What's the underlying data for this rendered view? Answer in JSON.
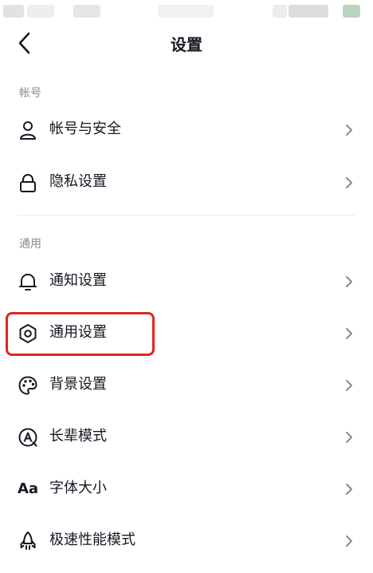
{
  "header": {
    "title": "设置"
  },
  "sections": [
    {
      "title": "帐号",
      "items": [
        {
          "label": "帐号与安全",
          "icon": "person-icon"
        },
        {
          "label": "隐私设置",
          "icon": "lock-icon"
        }
      ]
    },
    {
      "title": "通用",
      "items": [
        {
          "label": "通知设置",
          "icon": "bell-icon"
        },
        {
          "label": "通用设置",
          "icon": "gear-icon"
        },
        {
          "label": "背景设置",
          "icon": "palette-icon"
        },
        {
          "label": "长辈模式",
          "icon": "elder-mode-icon"
        },
        {
          "label": "字体大小",
          "icon": "font-size-icon",
          "icon_text": "Aa"
        },
        {
          "label": "极速性能模式",
          "icon": "rocket-icon"
        }
      ]
    }
  ],
  "highlight_color": "#e0261f"
}
